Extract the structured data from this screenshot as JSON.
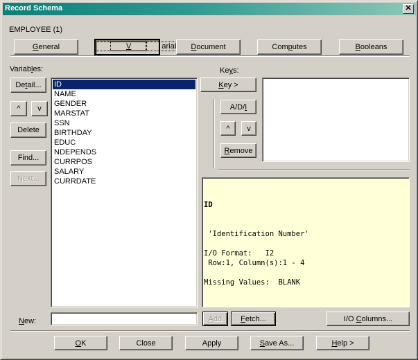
{
  "window": {
    "title": "Record Schema",
    "close_label": "✕"
  },
  "record_label": "EMPLOYEE (1)",
  "tabs": [
    {
      "label": "General",
      "mnemonic": "G",
      "rest": "eneral",
      "active": false
    },
    {
      "label": "Variables",
      "mnemonic": "V",
      "rest": "ariables",
      "active": true
    },
    {
      "label": "Document",
      "mnemonic": "D",
      "rest": "ocument",
      "active": false
    },
    {
      "label": "Computes",
      "pre": "Com",
      "mnemonic": "p",
      "rest": "utes",
      "active": false
    },
    {
      "label": "Booleans",
      "mnemonic": "B",
      "rest": "ooleans",
      "active": false
    }
  ],
  "variables": {
    "label_pre": "Variab",
    "label_mn": "l",
    "label_post": "es:",
    "items": [
      "ID",
      "NAME",
      "GENDER",
      "MARSTAT",
      "SSN",
      "BIRTHDAY",
      "EDUC",
      "NDEPENDS",
      "CURRPOS",
      "SALARY",
      "CURRDATE"
    ],
    "selected_index": 0
  },
  "left_buttons": {
    "detail_pre": "De",
    "detail_mn": "t",
    "detail_post": "ail...",
    "up": "^",
    "down": "v",
    "delete": "Delete",
    "find": "Find...",
    "next": "Next..."
  },
  "keys": {
    "label_pre": "Ke",
    "label_mn": "y",
    "label_post": "s:",
    "key_btn_mn": "K",
    "key_btn_post": "ey >",
    "adi_pre": "A/D/",
    "adi_mn": "I",
    "up": "^",
    "down": "v",
    "remove_mn": "R",
    "remove_post": "emove",
    "items": []
  },
  "info": {
    "name": "ID",
    "lines": [
      " 'Identification Number'",
      "",
      "I/O Format:   I2",
      " Row:1, Column(s):1 - 4",
      "",
      "Missing Values:  BLANK"
    ]
  },
  "new_field": {
    "label_mn": "N",
    "label_post": "ew:",
    "value": ""
  },
  "action_buttons": {
    "add_mn": "A",
    "add_post": "dd",
    "fetch_mn": "F",
    "fetch_post": "etch...",
    "io_pre": "I/O ",
    "io_mn": "C",
    "io_post": "olumns..."
  },
  "footer_buttons": {
    "ok_mn": "O",
    "ok_post": "K",
    "close": "Close",
    "apply": "Apply",
    "saveas_mn": "S",
    "saveas_post": "ave As...",
    "help_mn": "H",
    "help_post": "elp >"
  }
}
